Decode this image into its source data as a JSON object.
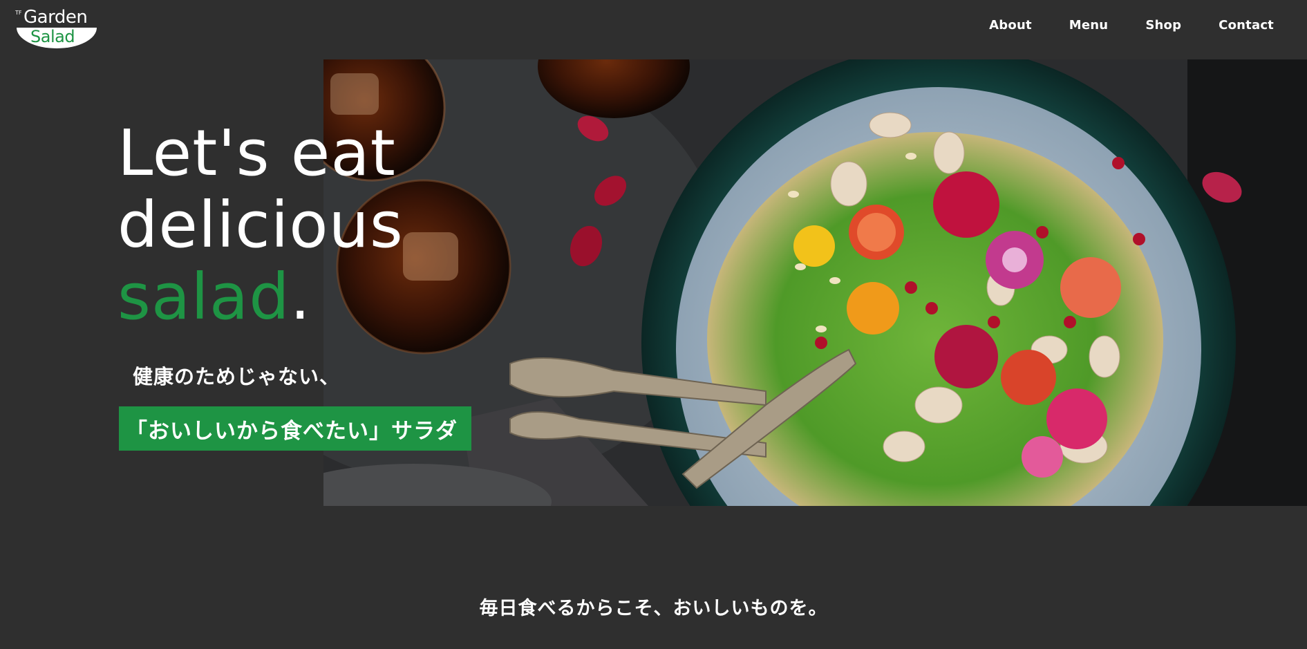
{
  "brand": {
    "prefix": "TF",
    "name_top": "Garden",
    "name_bottom": "Salad",
    "accent_color": "#1e9444",
    "background_color": "#2f2f2f"
  },
  "nav": {
    "items": [
      {
        "label": "About"
      },
      {
        "label": "Menu"
      },
      {
        "label": "Shop"
      },
      {
        "label": "Contact"
      }
    ]
  },
  "hero": {
    "headline_line1": "Let's eat",
    "headline_line2": "delicious",
    "headline_highlight": "salad",
    "headline_period": ".",
    "sub_line1": "健康のためじゃない、",
    "sub_line2": "「おいしいから食べたい」サラダ",
    "image_icon": "salad-bowl-photo"
  },
  "section": {
    "tagline": "毎日食べるからこそ、おいしいものを。"
  }
}
